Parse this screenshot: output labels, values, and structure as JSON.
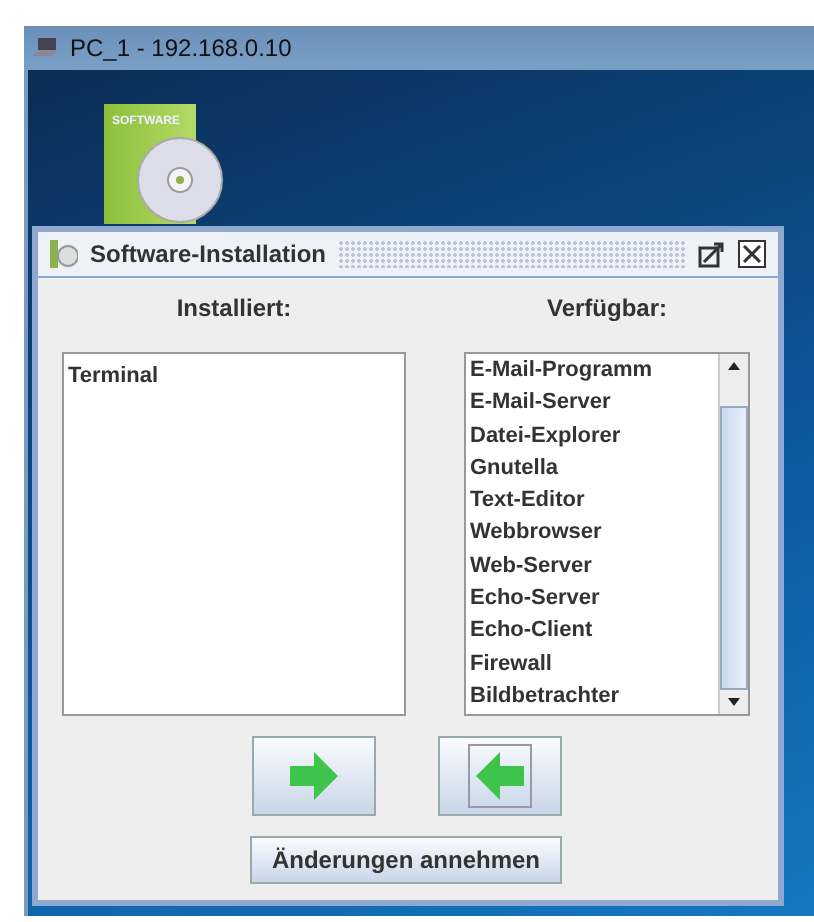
{
  "window": {
    "title": "PC_1 - 192.168.0.10"
  },
  "desktop_icon": {
    "box_text": "SOFTWARE"
  },
  "dialog": {
    "title": "Software-Installation",
    "installed": {
      "label": "Installiert:",
      "items": [
        "Terminal"
      ]
    },
    "available": {
      "label": "Verfügbar:",
      "items": [
        "E-Mail-Programm",
        "E-Mail-Server",
        "Datei-Explorer",
        "Gnutella",
        "Text-Editor",
        "Webbrowser",
        "Web-Server",
        "Echo-Server",
        "Echo-Client",
        "Firewall",
        "Bildbetrachter"
      ]
    },
    "move_buttons": [
      {
        "kind": "right",
        "focused": false
      },
      {
        "kind": "left",
        "focused": true
      }
    ],
    "apply_button": "Änderungen annehmen"
  }
}
